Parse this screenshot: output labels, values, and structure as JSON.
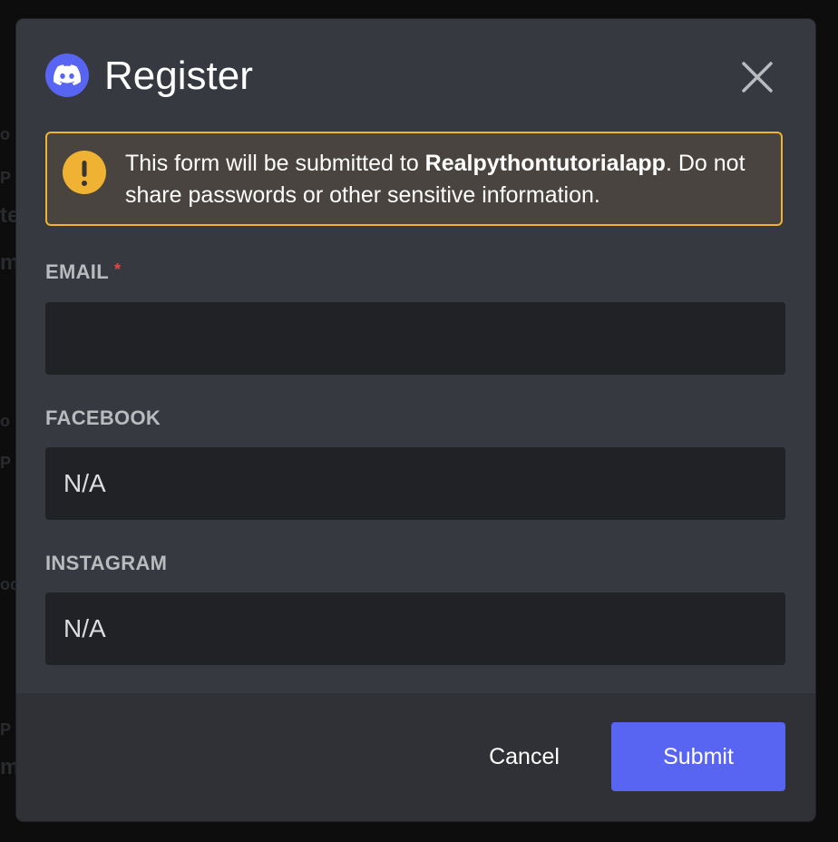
{
  "background": {
    "fragments": [
      "o",
      "P",
      "te",
      "m",
      "o",
      "P",
      "oc",
      "P",
      "m"
    ]
  },
  "modal": {
    "title": "Register",
    "logo_icon": "discord-logo-icon",
    "close_icon": "close-icon"
  },
  "warning": {
    "icon": "exclamation-icon",
    "text_before": "This form will be submitted to ",
    "app_name": "Realpythontutorialapp",
    "text_after": ". Do not share passwords or other sensitive information.",
    "border_color": "#f0b232"
  },
  "fields": {
    "email": {
      "label": "EMAIL",
      "required_mark": "*",
      "value": ""
    },
    "facebook": {
      "label": "FACEBOOK",
      "placeholder": "N/A"
    },
    "instagram": {
      "label": "INSTAGRAM",
      "placeholder": "N/A"
    }
  },
  "footer": {
    "cancel_label": "Cancel",
    "submit_label": "Submit"
  },
  "colors": {
    "accent": "#5865f2",
    "required": "#ed4245",
    "warning": "#f0b232"
  }
}
